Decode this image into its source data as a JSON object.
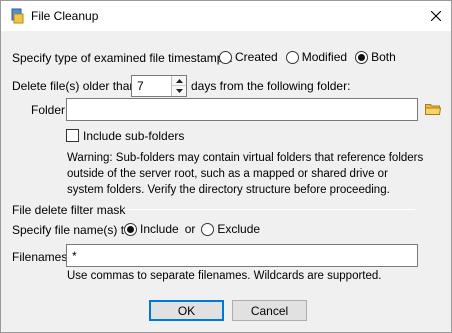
{
  "window": {
    "title": "File Cleanup"
  },
  "timestamps": {
    "label": "Specify type of examined file timestamps:",
    "options": [
      {
        "label": "Created",
        "checked": false
      },
      {
        "label": "Modified",
        "checked": false
      },
      {
        "label": "Both",
        "checked": true
      }
    ]
  },
  "age": {
    "prefix": "Delete file(s) older than",
    "days_value": "7",
    "suffix": "days from the following folder:"
  },
  "folder": {
    "label": "Folder:",
    "value": ""
  },
  "subfolders": {
    "label": "Include sub-folders",
    "checked": false,
    "warning": "Warning: Sub-folders may contain virtual folders that reference folders outside of the server root, such as a mapped or shared drive or system folders. Verify the directory structure before proceeding."
  },
  "filter": {
    "section_label": "File delete filter mask",
    "specify_label": "Specify file name(s) to",
    "include_label": "Include",
    "or_label": "or",
    "exclude_label": "Exclude",
    "include_checked": true,
    "filenames_label": "Filenames:",
    "filenames_value": "*",
    "hint": "Use commas to separate filenames. Wildcards are supported."
  },
  "buttons": {
    "ok": "OK",
    "cancel": "Cancel"
  },
  "icons": {
    "app": "file-cleanup-app-icon",
    "close": "close-icon",
    "browse": "folder-browse-icon"
  },
  "colors": {
    "folder_icon": "#e8b93a",
    "accent": "#0078d7"
  }
}
